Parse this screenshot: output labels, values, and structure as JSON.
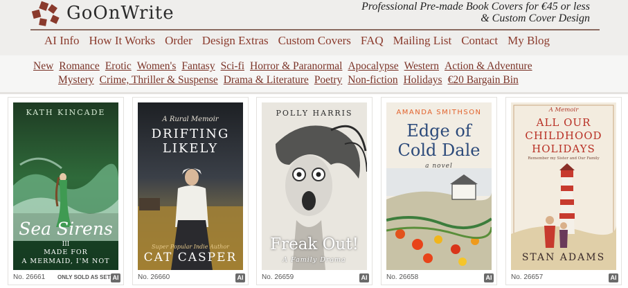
{
  "header": {
    "logo_text": "GoOnWrite",
    "tagline_line1": "Professional Pre-made Book Covers for €45 or less",
    "tagline_line2": "& Custom Cover Design"
  },
  "main_nav": [
    "AI Info",
    "How It Works",
    "Order",
    "Design Extras",
    "Custom Covers",
    "FAQ",
    "Mailing List",
    "Contact",
    "My Blog"
  ],
  "categories_row1": [
    "New",
    "Romance",
    "Erotic",
    "Women's",
    "Fantasy",
    "Sci-fi",
    "Horror & Paranormal",
    "Apocalypse",
    "Western",
    "Action & Adventure"
  ],
  "categories_row2": [
    "Mystery",
    "Crime, Thriller & Suspense",
    "Drama & Literature",
    "Poetry",
    "Non-fiction",
    "Holidays",
    "€20 Bargain Bin"
  ],
  "covers": [
    {
      "author": "KATH KINCADE",
      "title": "Sea Sirens",
      "volume": "III",
      "subtitle_1": "MADE FOR",
      "subtitle_2": "A MERMAID, I'M NOT",
      "number": "No. 26661",
      "note": "ONLY SOLD AS SET",
      "ai_badge": "AI"
    },
    {
      "kicker": "A Rural Memoir",
      "title_1": "DRIFTING",
      "title_2": "LIKELY",
      "tagline": "Super Popular Indie Author",
      "author": "CAT CASPER",
      "number": "No. 26660",
      "ai_badge": "AI"
    },
    {
      "author": "POLLY HARRIS",
      "title": "Freak Out!",
      "subtitle": "A Family Drama",
      "number": "No. 26659",
      "ai_badge": "AI"
    },
    {
      "author": "AMANDA SMITHSON",
      "title_1": "Edge of",
      "title_2": "Cold Dale",
      "subtitle": "a novel",
      "number": "No. 26658",
      "ai_badge": "AI"
    },
    {
      "kicker": "A Memoir",
      "title_1": "ALL OUR",
      "title_2": "CHILDHOOD",
      "title_3": "HOLIDAYS",
      "subtitle": "Remember my Sister and Our Family",
      "author": "STAN ADAMS",
      "number": "No. 26657",
      "ai_badge": "AI"
    }
  ]
}
